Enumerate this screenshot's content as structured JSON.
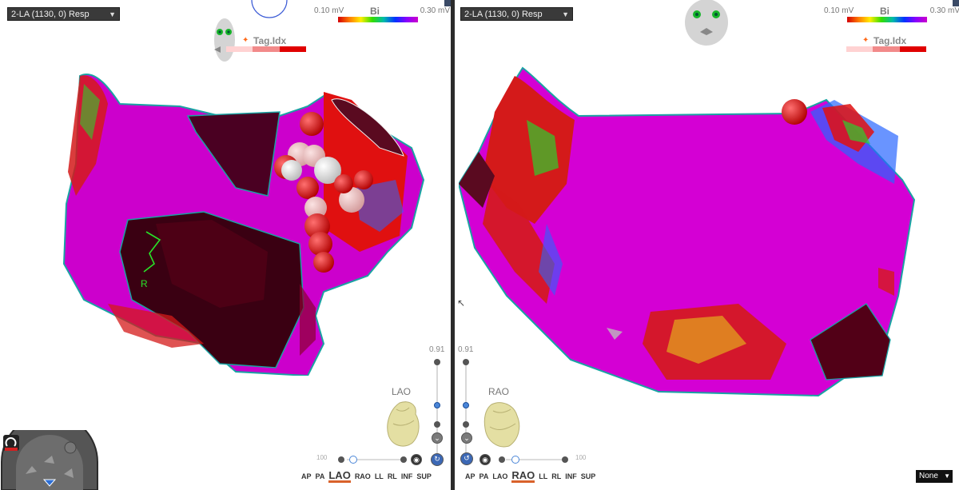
{
  "panes": [
    {
      "map_selector": "2-LA (1130, 0) Resp",
      "legend": {
        "low": "0.10 mV",
        "title": "Bi",
        "high": "0.30 mV"
      },
      "tag_index_label": "Tag.Idx",
      "scale_value": "0.91",
      "view_label": "LAO",
      "lesion_marker": "R",
      "small_slider_left": "100",
      "view_buttons": [
        "AP",
        "PA",
        "LAO",
        "RAO",
        "LL",
        "RL",
        "INF",
        "SUP"
      ],
      "active_view": "LAO"
    },
    {
      "map_selector": "2-LA (1130, 0) Resp",
      "legend": {
        "low": "0.10 mV",
        "title": "Bi",
        "high": "0.30 mV"
      },
      "tag_index_label": "Tag.Idx",
      "scale_value": "0.91",
      "view_label": "RAO",
      "small_slider_right": "100",
      "view_buttons": [
        "AP",
        "PA",
        "LAO",
        "RAO",
        "LL",
        "RL",
        "INF",
        "SUP"
      ],
      "active_view": "RAO"
    }
  ],
  "projection_dropdown": "None",
  "colors": {
    "accent_view": "#d9622b",
    "lesion_red": "#e00000",
    "scar": "#3a0012",
    "healthy": "#d400d4"
  },
  "icons": [
    "face-orientation-icon",
    "heart-orientation-icon",
    "tool-dial-icon",
    "cursor-icon"
  ]
}
